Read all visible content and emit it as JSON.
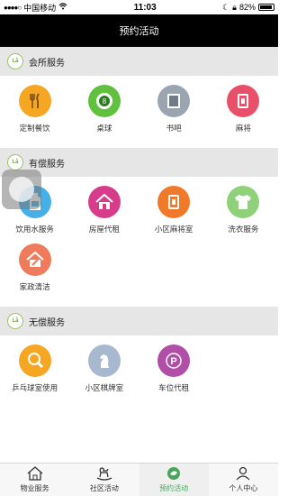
{
  "status": {
    "carrier": "中国移动",
    "time": "11:03",
    "battery": "82%"
  },
  "title": "预约活动",
  "sections": [
    {
      "title": "会所服务",
      "items": [
        {
          "label": "定制餐饮",
          "icon": "utensils-icon",
          "color": "#f5a623"
        },
        {
          "label": "桌球",
          "icon": "billiard-ball-icon",
          "color": "#5fc13e"
        },
        {
          "label": "书吧",
          "icon": "book-icon",
          "color": "#9aa5b1"
        },
        {
          "label": "麻将",
          "icon": "mahjong-icon",
          "color": "#e8506a"
        }
      ]
    },
    {
      "title": "有偿服务",
      "items": [
        {
          "label": "饮用水服务",
          "icon": "water-bottle-icon",
          "color": "#46b0e6"
        },
        {
          "label": "房屋代租",
          "icon": "house-icon",
          "color": "#d63c8a"
        },
        {
          "label": "小区麻将室",
          "icon": "mahjong-room-icon",
          "color": "#f07a2a"
        },
        {
          "label": "洗衣服务",
          "icon": "laundry-icon",
          "color": "#8fd17a"
        },
        {
          "label": "家政清洁",
          "icon": "cleaning-icon",
          "color": "#ee7c5c"
        }
      ]
    },
    {
      "title": "无偿服务",
      "items": [
        {
          "label": "乒乓球室使用",
          "icon": "ping-pong-icon",
          "color": "#f5a623"
        },
        {
          "label": "小区棋牌室",
          "icon": "chess-knight-icon",
          "color": "#a8b8cf"
        },
        {
          "label": "车位代租",
          "icon": "parking-icon",
          "color": "#b04ea8"
        }
      ]
    }
  ],
  "tabs": [
    {
      "label": "物业服务",
      "icon": "home-icon"
    },
    {
      "label": "社区活动",
      "icon": "rocking-horse-icon"
    },
    {
      "label": "预约活动",
      "icon": "calendar-leaf-icon",
      "active": true
    },
    {
      "label": "个人中心",
      "icon": "user-icon"
    }
  ]
}
